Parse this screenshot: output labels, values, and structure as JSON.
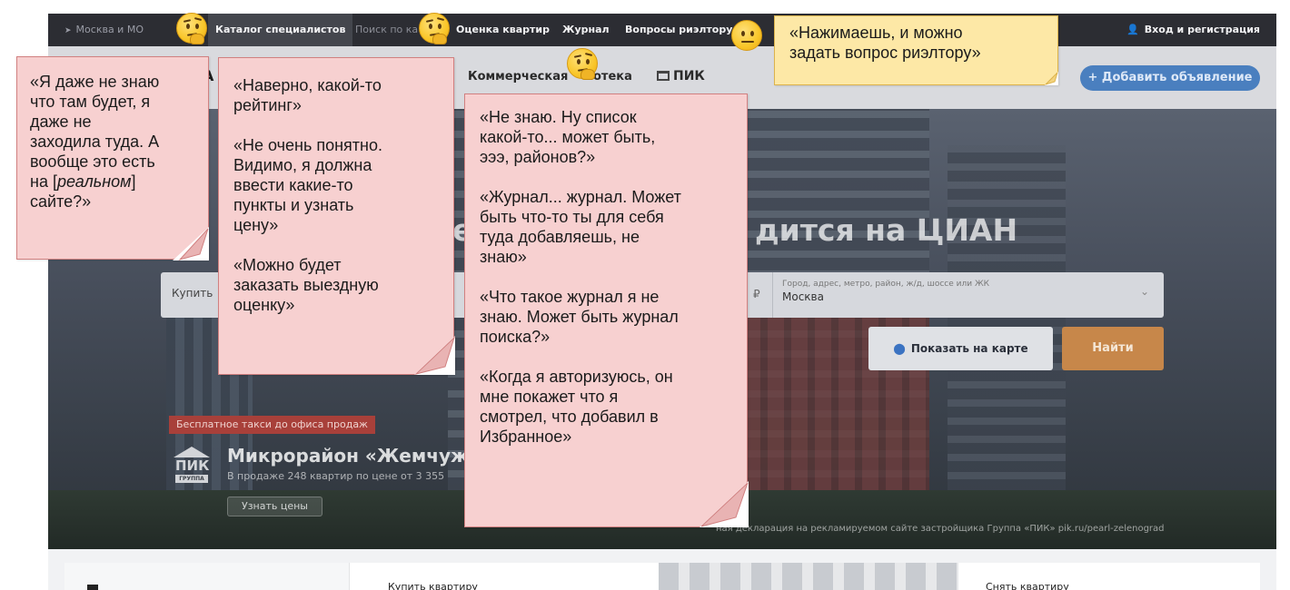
{
  "site": {
    "topbar": {
      "region": "Москва и МО",
      "nav": {
        "catalog": "Каталог специалистов",
        "search_stub": "Поиск по ка",
        "valuation": "Оценка квартир",
        "journal": "Журнал",
        "realtor_questions": "Вопросы риэлтору"
      },
      "login": "Вход и регистрация"
    },
    "menubar": {
      "logo_stub": "А",
      "commercial": "Коммерческая",
      "mortgage": "потека",
      "pik": "ПИК",
      "add_ad_button": "+ Добавить объявление"
    },
    "hero": {
      "title_fragment": "е",
      "title_tail": "дится на ЦИАН",
      "search": {
        "deal_type": "Купить",
        "currency": "₽",
        "geo_placeholder": "Город, адрес, метро, район, ж/д, шоссе или ЖК",
        "geo_value": "Москва"
      },
      "map_button": "Показать на карте",
      "find_button": "Найти",
      "promo": {
        "tag": "Бесплатное такси до офиса продаж",
        "logo_word": "ПИК",
        "logo_group": "ГРУППА",
        "title": "Микрорайон «Жемчужин",
        "subtitle": "В продаже 248 квартир по цене от 3 355",
        "prices_button": "Узнать цены",
        "disclaimer": "ная декларация на рекламируемом сайте застройщика Группа «ПИК» pik.ru/pearl-zelenograd"
      }
    },
    "cards": {
      "buy": "Купить квартиру",
      "rent": "Снять квартиру"
    }
  },
  "callouts": {
    "note1": [
      "«Я даже не знаю",
      "что там будет, я",
      "даже не",
      "заходила туда. А",
      "вообще это есть",
      "на [",
      "реальном",
      "]",
      "сайте?»"
    ],
    "note2": {
      "p1": [
        "«Наверно, какой-то",
        "рейтинг»"
      ],
      "p2": [
        "«Не очень понятно.",
        "Видимо, я должна",
        "ввести какие-то",
        "пункты и узнать",
        "цену»"
      ],
      "p3": [
        "«Можно будет",
        "заказать выездную",
        "оценку»"
      ]
    },
    "note3": {
      "p1": [
        "«Не знаю. Ну список",
        "какой-то... может быть,",
        "эээ, районов?»"
      ],
      "p2": [
        "«Журнал... журнал. Может",
        "быть что-то ты для себя",
        "туда добавляешь, не",
        "знаю»"
      ],
      "p3": [
        "«Что такое журнал я не",
        "знаю. Может быть журнал",
        "поиска?»"
      ],
      "p4": [
        "«Когда я авторизуюсь, он",
        "мне покажет что я",
        "смотрел, что добавил в",
        "Избранное»"
      ]
    },
    "note4": [
      "«Нажимаешь, и можно",
      "задать вопрос риэлтору»"
    ]
  },
  "emojis": [
    "thinking-face-icon",
    "thinking-face-icon",
    "thinking-face-icon",
    "neutral-face-icon"
  ],
  "colors": {
    "topbar": "#2c2d33",
    "callout_pink": "#f7d0d0",
    "callout_yellow": "#fde8a6",
    "accent_blue": "#4a7fbf",
    "accent_orange": "#c7874a",
    "promo_red": "#a8403a"
  }
}
